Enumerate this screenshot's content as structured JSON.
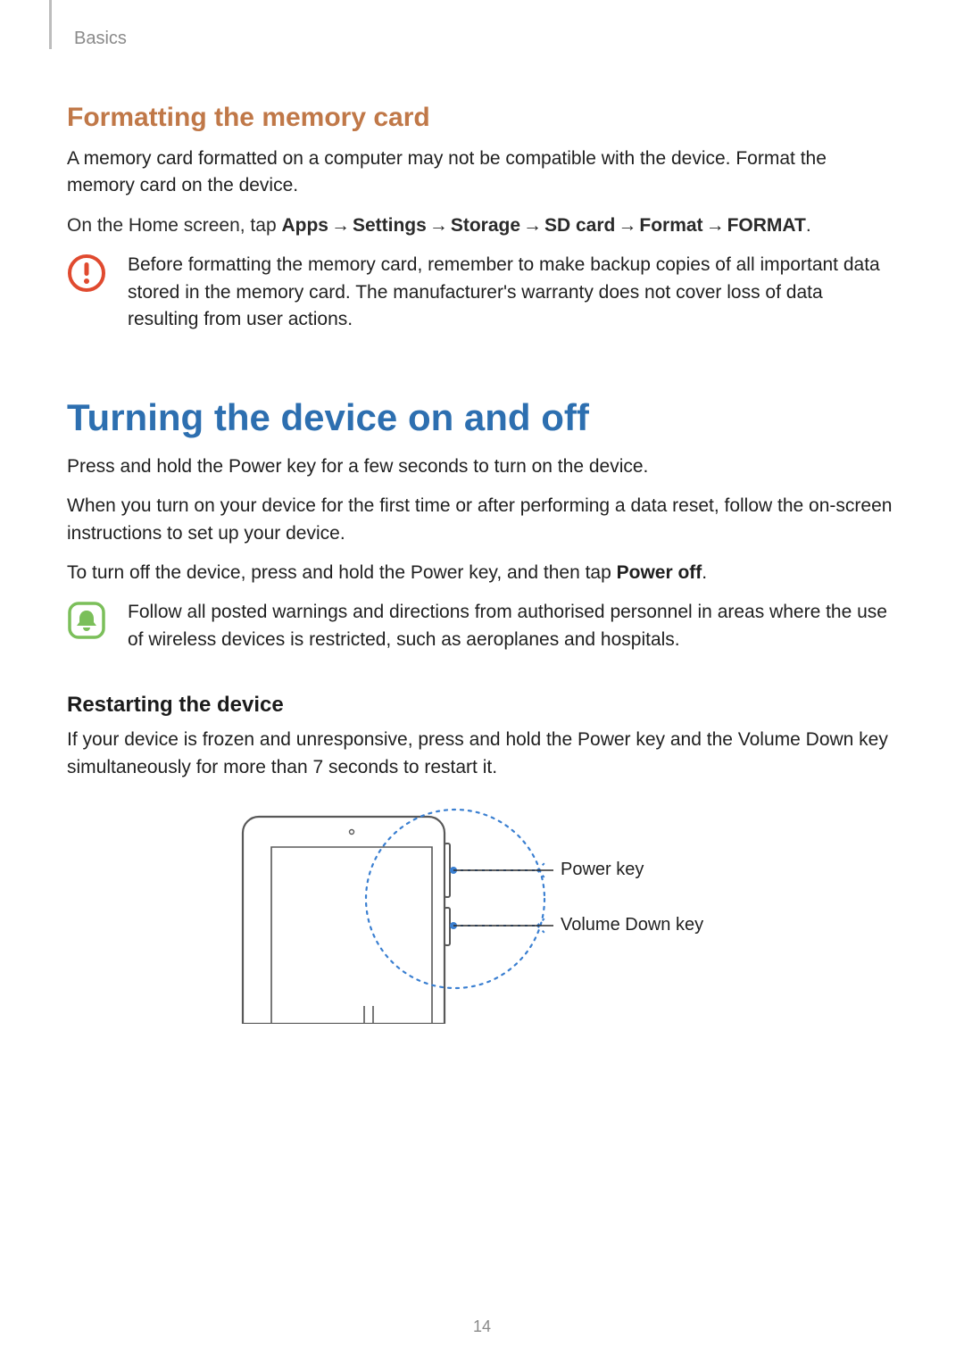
{
  "breadcrumb": "Basics",
  "section1": {
    "title": "Formatting the memory card",
    "para1": "A memory card formatted on a computer may not be compatible with the device. Format the memory card on the device.",
    "path_prefix": "On the Home screen, tap ",
    "path": [
      "Apps",
      "Settings",
      "Storage",
      "SD card",
      "Format",
      "FORMAT"
    ],
    "path_suffix": ".",
    "warning": "Before formatting the memory card, remember to make backup copies of all important data stored in the memory card. The manufacturer's warranty does not cover loss of data resulting from user actions."
  },
  "section2": {
    "title": "Turning the device on and off",
    "para1": "Press and hold the Power key for a few seconds to turn on the device.",
    "para2": "When you turn on your device for the first time or after performing a data reset, follow the on-screen instructions to set up your device.",
    "para3_prefix": "To turn off the device, press and hold the Power key, and then tap ",
    "para3_bold": "Power off",
    "para3_suffix": ".",
    "info": "Follow all posted warnings and directions from authorised personnel in areas where the use of wireless devices is restricted, such as aeroplanes and hospitals."
  },
  "section3": {
    "title": "Restarting the device",
    "para1": "If your device is frozen and unresponsive, press and hold the Power key and the Volume Down key simultaneously for more than 7 seconds to restart it."
  },
  "diagram": {
    "label_power": "Power key",
    "label_volume": "Volume Down key"
  },
  "page_number": "14"
}
